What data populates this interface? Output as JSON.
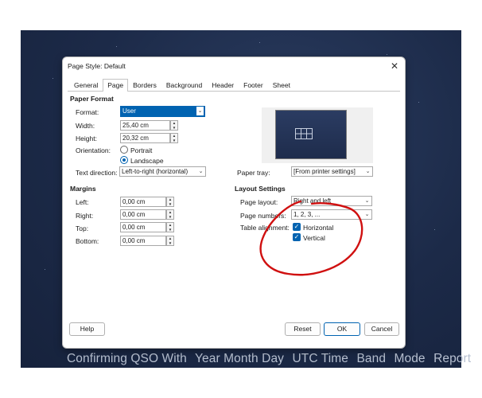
{
  "dialog": {
    "title": "Page Style: Default",
    "close_glyph": "✕"
  },
  "tabs": [
    {
      "label": "General",
      "active": false
    },
    {
      "label": "Page",
      "active": true
    },
    {
      "label": "Borders",
      "active": false
    },
    {
      "label": "Background",
      "active": false
    },
    {
      "label": "Header",
      "active": false
    },
    {
      "label": "Footer",
      "active": false
    },
    {
      "label": "Sheet",
      "active": false
    }
  ],
  "paper_format": {
    "heading": "Paper Format",
    "format_label": "Format:",
    "format_value": "User",
    "width_label": "Width:",
    "width_value": "25,40 cm",
    "height_label": "Height:",
    "height_value": "20,32 cm",
    "orientation_label": "Orientation:",
    "portrait_label": "Portrait",
    "landscape_label": "Landscape",
    "orientation_selected": "Landscape",
    "text_direction_label": "Text direction:",
    "text_direction_value": "Left-to-right (horizontal)",
    "paper_tray_label": "Paper tray:",
    "paper_tray_value": "[From printer settings]"
  },
  "margins": {
    "heading": "Margins",
    "left_label": "Left:",
    "left_value": "0,00 cm",
    "right_label": "Right:",
    "right_value": "0,00 cm",
    "top_label": "Top:",
    "top_value": "0,00 cm",
    "bottom_label": "Bottom:",
    "bottom_value": "0,00 cm"
  },
  "layout_settings": {
    "heading": "Layout Settings",
    "page_layout_label": "Page layout:",
    "page_layout_value": "Right and left",
    "page_numbers_label": "Page numbers:",
    "page_numbers_value": "1, 2, 3, ...",
    "table_alignment_label": "Table alignment:",
    "horizontal_label": "Horizontal",
    "horizontal_checked": true,
    "vertical_label": "Vertical",
    "vertical_checked": true
  },
  "buttons": {
    "help": "Help",
    "reset": "Reset",
    "ok": "OK",
    "cancel": "Cancel"
  },
  "background_caption": [
    "Confirming QSO With",
    "Year Month Day",
    "UTC Time",
    "Band",
    "Mode",
    "Report"
  ],
  "colors": {
    "accent": "#0063b1",
    "annotation": "#d01010"
  }
}
